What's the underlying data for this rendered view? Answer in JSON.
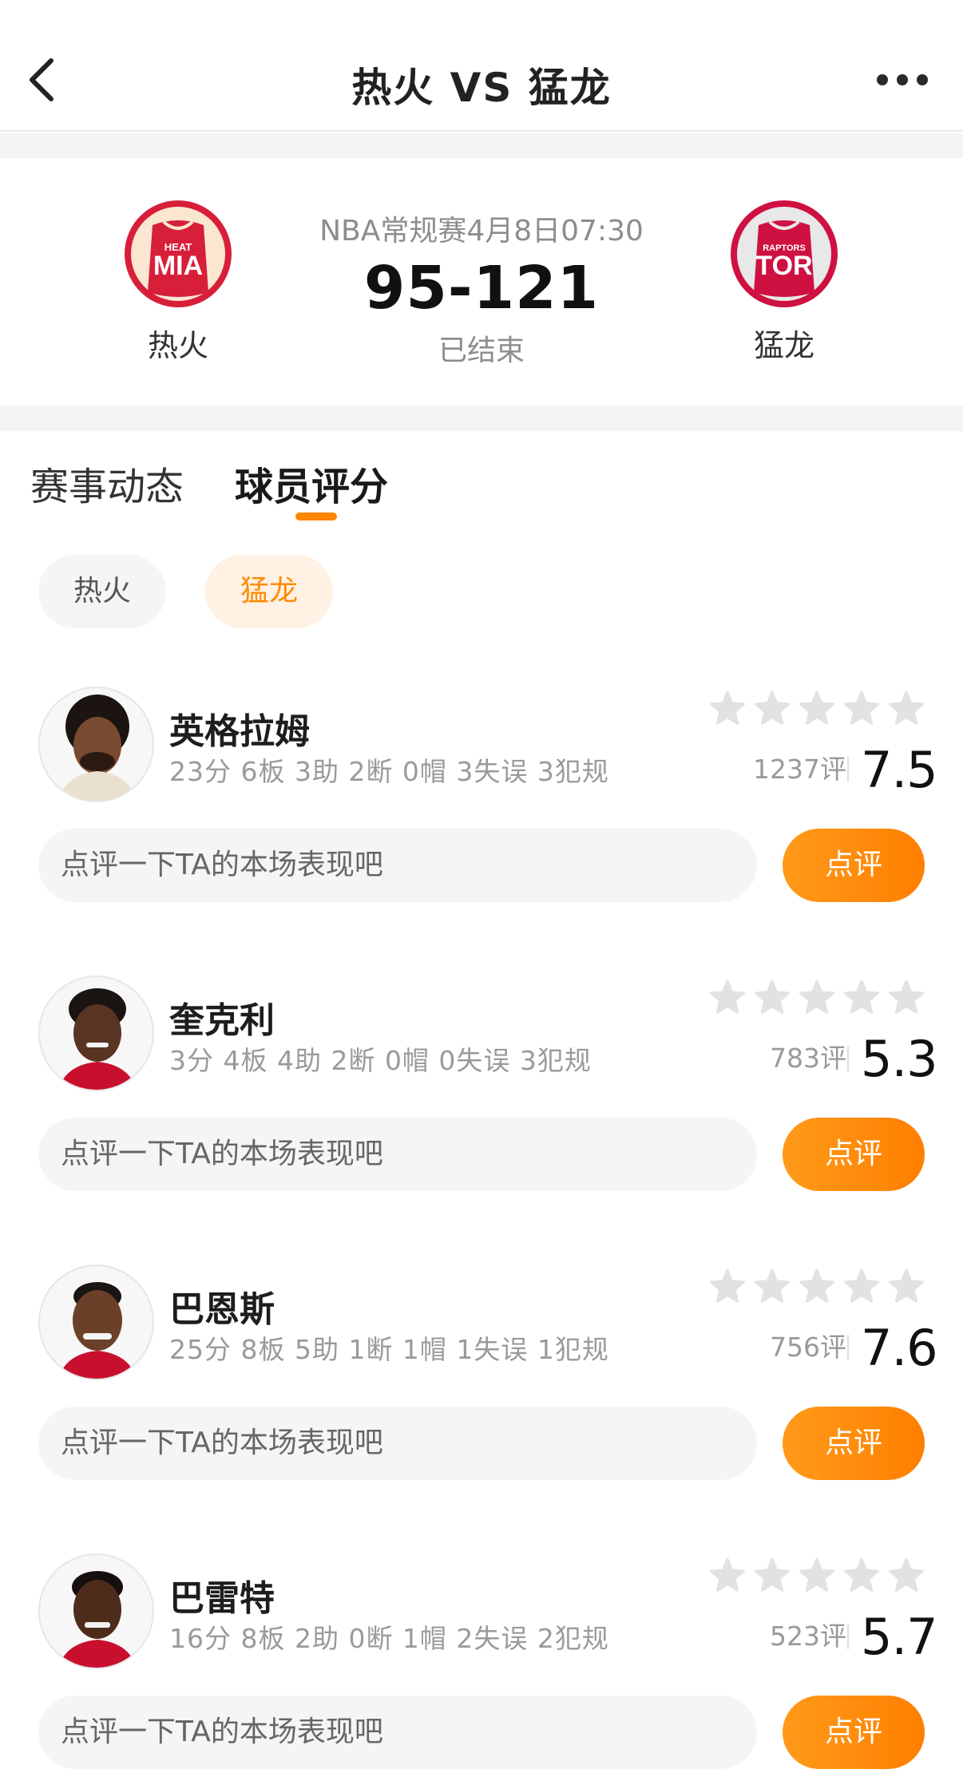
{
  "nav": {
    "title": "热火 VS 猛龙"
  },
  "match": {
    "home_team": {
      "name": "热火",
      "logo_text": "MIA",
      "logo_subtext": "HEAT",
      "color": "#d71f3a"
    },
    "away_team": {
      "name": "猛龙",
      "logo_text": "TOR",
      "logo_subtext": "RAPTORS",
      "color": "#ce1141"
    },
    "meta": "NBA常规赛4月8日07:30",
    "score": "95-121",
    "status": "已结束"
  },
  "tabs": [
    {
      "label": "赛事动态",
      "active": false
    },
    {
      "label": "球员评分",
      "active": true
    }
  ],
  "team_filter": [
    {
      "label": "热火",
      "active": false
    },
    {
      "label": "猛龙",
      "active": true
    }
  ],
  "comment_placeholder": "点评一下TA的本场表现吧",
  "comment_button": "点评",
  "players": [
    {
      "name": "英格拉姆",
      "stats": "23分 6板 3助 2断 0帽 3失误 3犯规",
      "votes": "1237评",
      "rating": "7.5"
    },
    {
      "name": "奎克利",
      "stats": "3分 4板 4助 2断 0帽 0失误 3犯规",
      "votes": "783评",
      "rating": "5.3"
    },
    {
      "name": "巴恩斯",
      "stats": "25分 8板 5助 1断 1帽 1失误 1犯规",
      "votes": "756评",
      "rating": "7.6"
    },
    {
      "name": "巴雷特",
      "stats": "16分 8板 2助 0断 1帽 2失误 2犯规",
      "votes": "523评",
      "rating": "5.7"
    }
  ],
  "colors": {
    "accent": "#ff8400",
    "star_empty": "#e2e2e2"
  }
}
